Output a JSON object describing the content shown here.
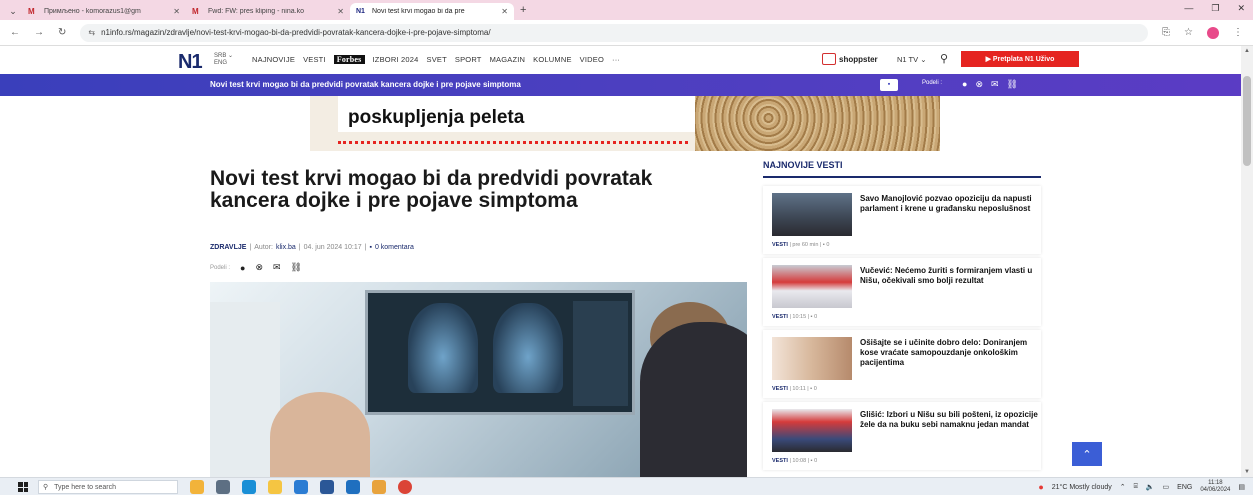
{
  "browser": {
    "tabs": [
      {
        "icon": "M",
        "title": "Примљено - komorazus1@gm"
      },
      {
        "icon": "M",
        "title": "Fwd: FW: pres kliping - nina.ko"
      },
      {
        "icon": "N1",
        "title": "Novi test krvi mogao bi da pre"
      }
    ],
    "new_tab": "+",
    "url": "n1info.rs/magazin/zdravlje/novi-test-krvi-mogao-bi-da-predvidi-povratak-kancera-dojke-i-pre-pojave-simptoma/"
  },
  "header": {
    "logo": "N1",
    "lang_primary": "SRB ⌄",
    "lang_secondary": "ENG",
    "nav": [
      "NAJNOVIJE",
      "VESTI",
      "Forbes",
      "IZBORI 2024",
      "SVET",
      "SPORT",
      "MAGAZIN",
      "KOLUMNE",
      "VIDEO",
      "···"
    ],
    "shopster": "shoppster",
    "n1tv": "N1 TV ⌄",
    "subscribe": "▶ Pretplata N1 Uživo"
  },
  "sticky": {
    "title": "Novi test krvi mogao bi da predvidi povratak kancera dojke i pre pojave simptoma",
    "share_label": "Podeli :"
  },
  "ad": {
    "text": "poskupljenja peleta"
  },
  "article": {
    "title": "Novi test krvi mogao bi da predvidi povratak kancera dojke i pre pojave simptoma",
    "category": "ZDRAVLJE",
    "sep1": "|",
    "author_label": "Autor:",
    "author": "klix.ba",
    "sep2": "|",
    "date": "04. jun 2024 10:17",
    "sep3": "|",
    "comments": "0 komentara",
    "share_label": "Podeli :"
  },
  "sidebar": {
    "title": "NAJNOVIJE VESTI",
    "items": [
      {
        "headline": "Savo Manojlović pozvao opoziciju da napusti parlament i krene u građansku neposlušnost",
        "category": "VESTI",
        "time": "| pre 60 min |",
        "comments": "0"
      },
      {
        "headline": "Vučević: Nećemo žuriti s formiranjem vlasti u Nišu, očekivali smo bolji rezultat",
        "category": "VESTI",
        "time": "| 10:15 |",
        "comments": "0"
      },
      {
        "headline": "Ošišajte se i učinite dobro delo: Doniranjem kose vraćate samopouzdanje onkološkim pacijentima",
        "category": "VESTI",
        "time": "| 10:11 |",
        "comments": "0"
      },
      {
        "headline": "Glišić: Izbori u Nišu su bili pošteni, iz opozicije žele da na buku sebi namaknu jedan mandat",
        "category": "VESTI",
        "time": "| 10:08 |",
        "comments": "0"
      }
    ]
  },
  "taskbar": {
    "search_placeholder": "Type here to search",
    "weather": "21°C  Mostly cloudy",
    "lang": "ENG",
    "time": "11:18",
    "date": "04/06/2024"
  },
  "colors": {
    "accent": "#3a3fbb",
    "brand_navy": "#1a2a6c",
    "subscribe_red": "#e52420",
    "tab_strip": "#f4d8e4"
  }
}
